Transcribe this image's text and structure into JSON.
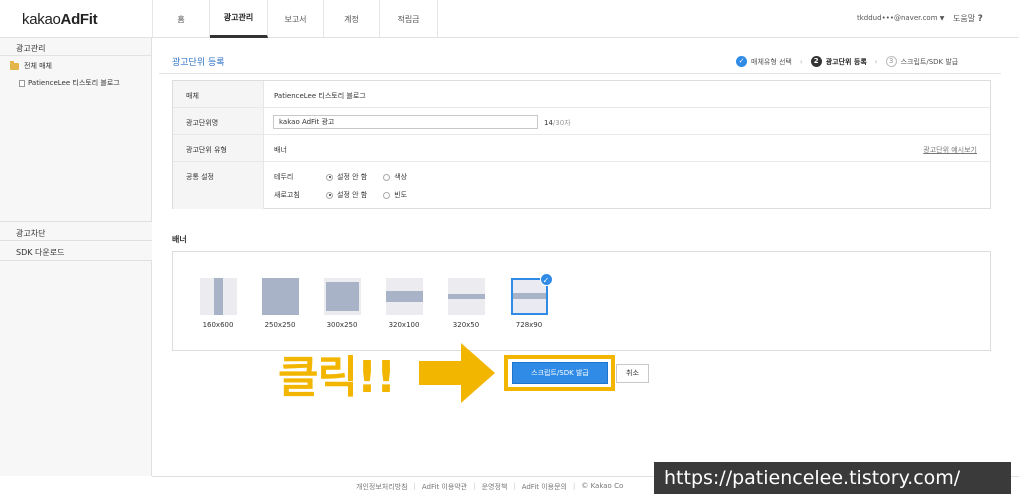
{
  "header": {
    "logo_prefix": "kakao",
    "logo_suffix": "AdFit",
    "nav": [
      "홈",
      "광고관리",
      "보고서",
      "계정",
      "적립금"
    ],
    "active_nav": "광고관리",
    "user": "tkddud•••@naver.com",
    "help": "도움말"
  },
  "sidebar": {
    "heading": "광고관리",
    "tree_root": "전체 매체",
    "tree_child": "PatienceLee 티스토리 블로그",
    "section_block": "광고차단",
    "section_sdk": "SDK 다운로드"
  },
  "page": {
    "title": "광고단위 등록",
    "steps": [
      {
        "num": "",
        "label": "매체유형 선택",
        "state": "done"
      },
      {
        "num": "2",
        "label": "광고단위 등록",
        "state": "current"
      },
      {
        "num": "3",
        "label": "스크립트/SDK 발급",
        "state": "todo"
      }
    ]
  },
  "form": {
    "media_label": "매체",
    "media_value": "PatienceLee 티스토리 블로그",
    "name_label": "광고단위명",
    "name_value": "kakao AdFit 광고",
    "name_count": "14",
    "name_max": "/30자",
    "type_label": "광고단위 유형",
    "type_value": "배너",
    "preview_link": "광고단위 예시보기",
    "common_label": "공통 설정",
    "border_label": "테두리",
    "border_opt1": "설정 안 함",
    "border_opt2": "색상",
    "refresh_label": "새로고침",
    "refresh_opt1": "설정 안 함",
    "refresh_opt2": "빈도"
  },
  "banner": {
    "title": "배너",
    "sizes": [
      "160x600",
      "250x250",
      "300x250",
      "320x100",
      "320x50",
      "728x90"
    ],
    "selected": "728x90"
  },
  "actions": {
    "annotation": "클릭!!",
    "issue": "스크립트/SDK 발급",
    "cancel": "취소"
  },
  "footer": {
    "links": [
      "개인정보처리방침",
      "AdFit 이용약관",
      "운영정책",
      "AdFit 이용문의",
      "© Kakao Co"
    ],
    "watermark": "https://patiencelee.tistory.com/"
  },
  "colors": {
    "accent": "#2f8be6",
    "title": "#2f74c7",
    "annotation": "#f3b600",
    "banner_fill": "#a8b3c8"
  }
}
